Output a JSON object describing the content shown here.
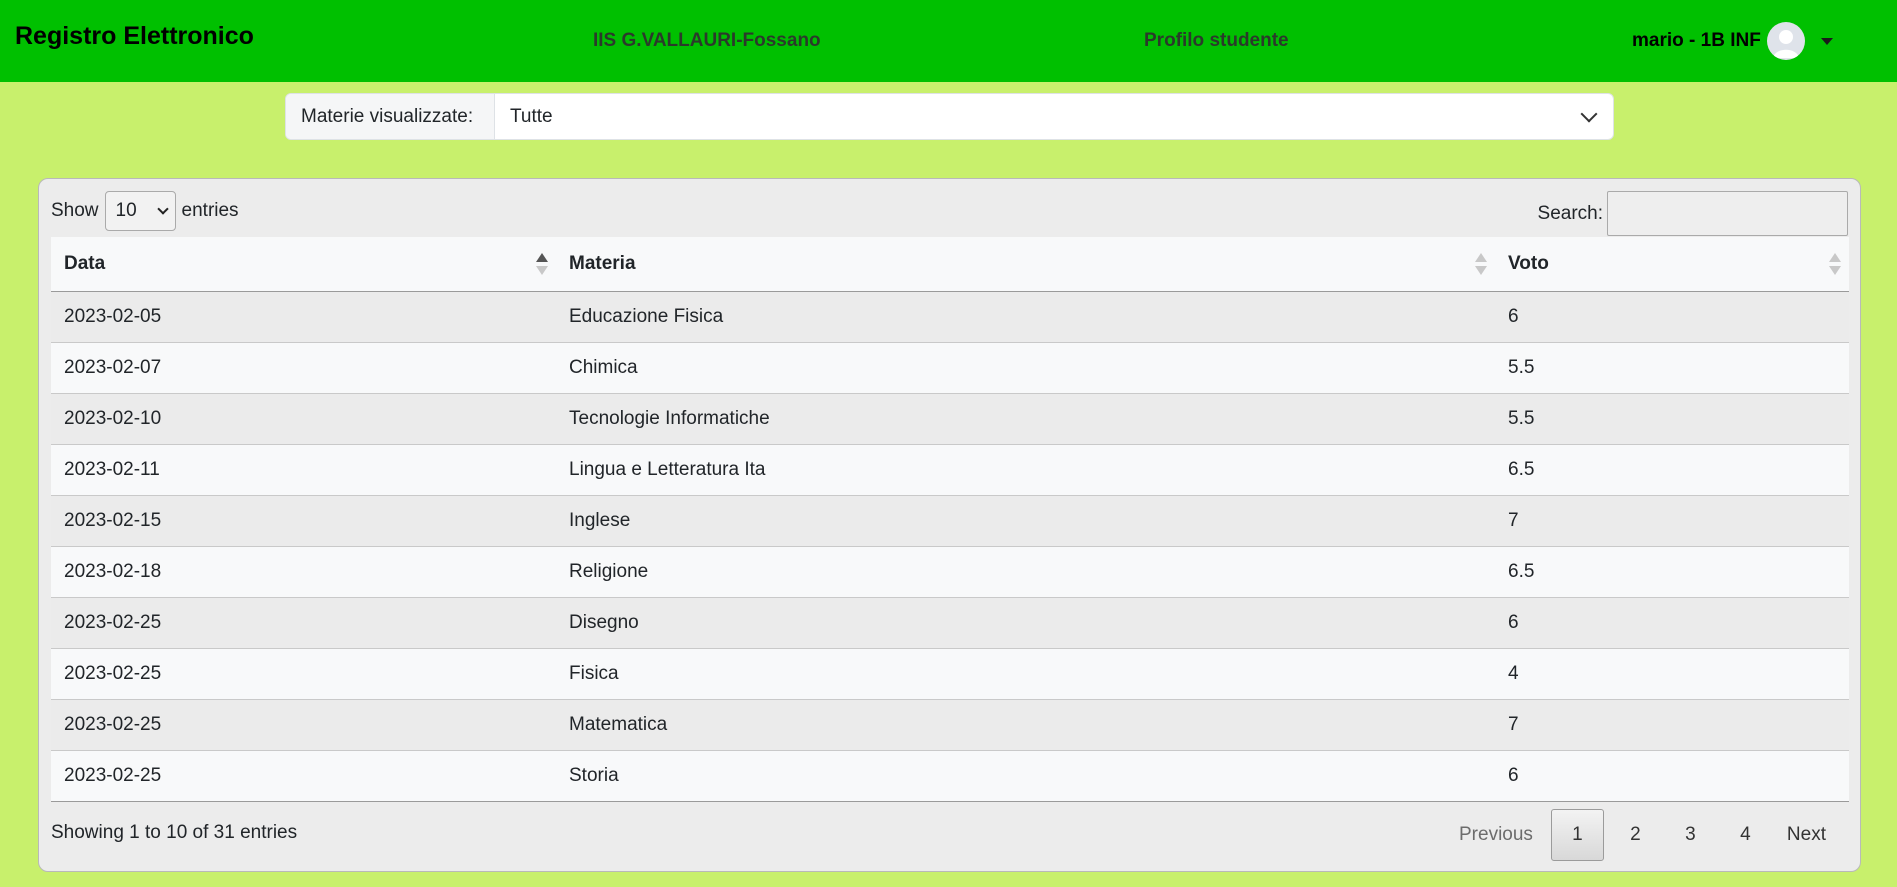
{
  "navbar": {
    "brand": "Registro Elettronico",
    "school": "IIS G.VALLAURI-Fossano",
    "profile": "Profilo studente",
    "user": "mario - 1B INF",
    "bg_color": "#00c000"
  },
  "filter": {
    "label": "Materie visualizzate:",
    "selected": "Tutte"
  },
  "table_controls": {
    "show_label": "Show",
    "page_length": "10",
    "entries_label": "entries",
    "search_label": "Search:",
    "search_value": ""
  },
  "table": {
    "columns": [
      "Data",
      "Materia",
      "Voto"
    ],
    "sorted_column": "Data",
    "rows": [
      [
        "2023-02-05",
        "Educazione Fisica",
        "6"
      ],
      [
        "2023-02-07",
        "Chimica",
        "5.5"
      ],
      [
        "2023-02-10",
        "Tecnologie Informatiche",
        "5.5"
      ],
      [
        "2023-02-11",
        "Lingua e Letteratura Ita",
        "6.5"
      ],
      [
        "2023-02-15",
        "Inglese",
        "7"
      ],
      [
        "2023-02-18",
        "Religione",
        "6.5"
      ],
      [
        "2023-02-25",
        "Disegno",
        "6"
      ],
      [
        "2023-02-25",
        "Fisica",
        "4"
      ],
      [
        "2023-02-25",
        "Matematica",
        "7"
      ],
      [
        "2023-02-25",
        "Storia",
        "6"
      ]
    ]
  },
  "footer": {
    "info": "Showing 1 to 10 of 31 entries",
    "previous": "Previous",
    "pages": [
      "1",
      "2",
      "3",
      "4"
    ],
    "current_page": "1",
    "next": "Next"
  },
  "colors": {
    "page_bg": "#c8f06c",
    "navbar_bg": "#00c000"
  }
}
